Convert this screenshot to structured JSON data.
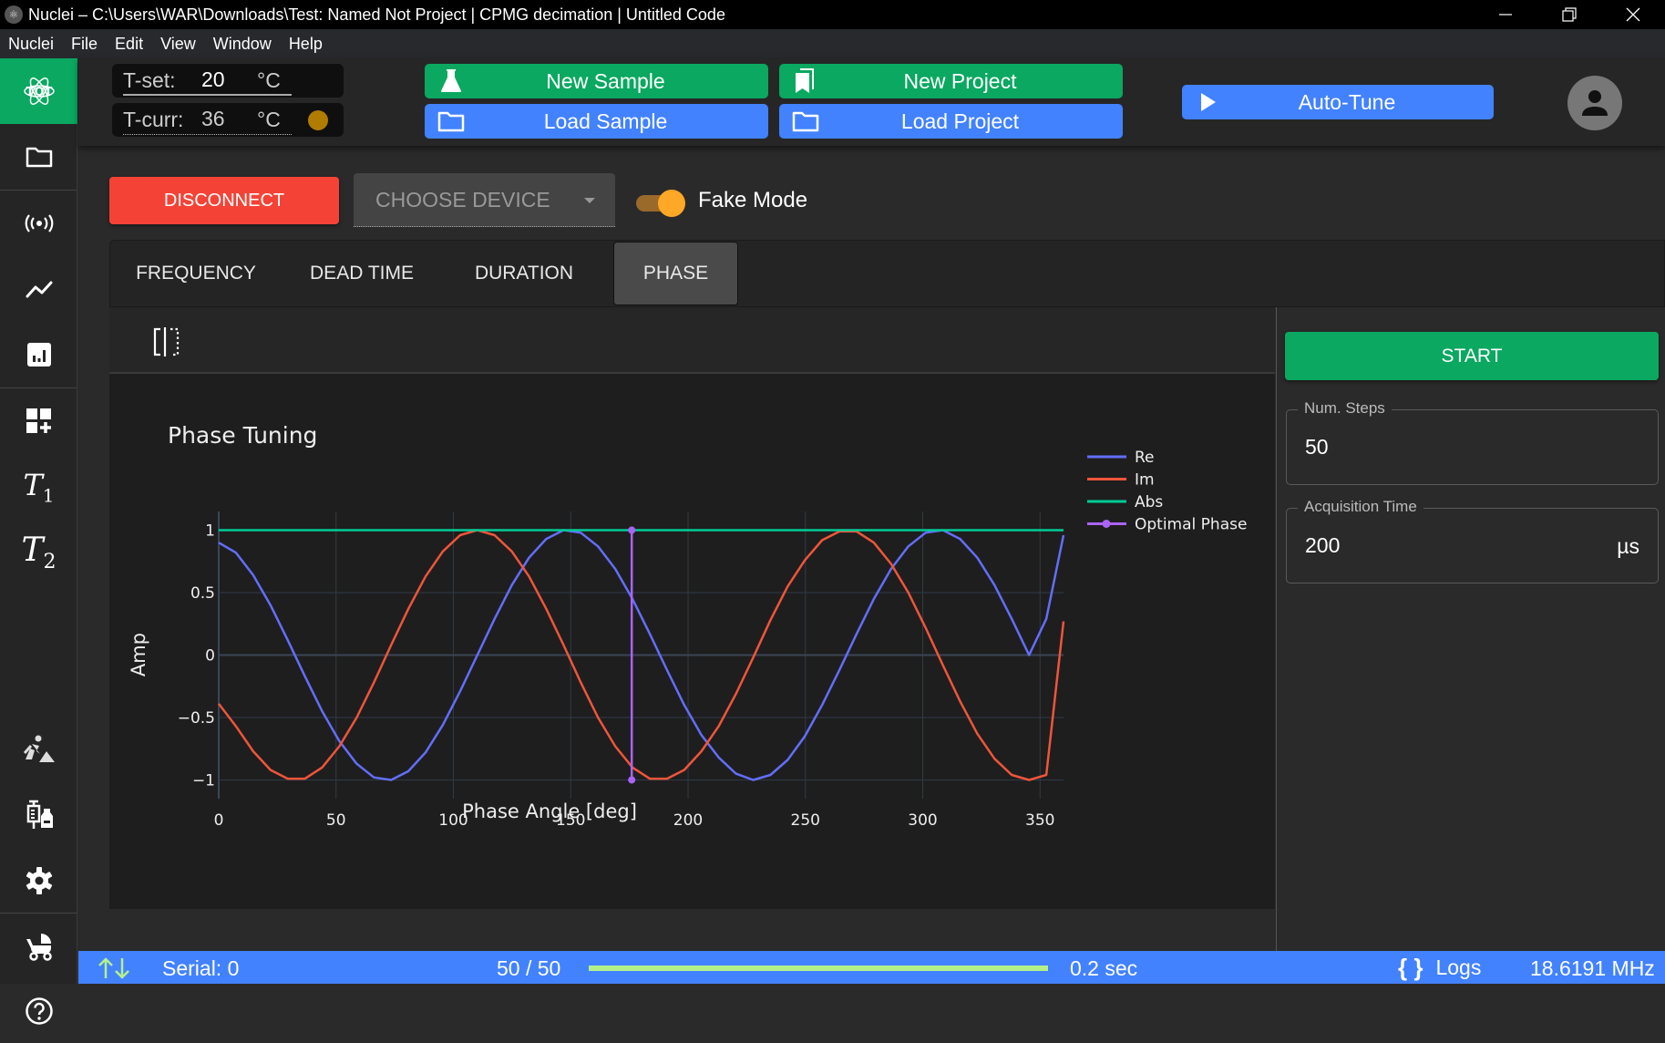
{
  "window": {
    "title": "Nuclei – C:\\Users\\WAR\\Downloads\\Test: Named Not Project | CPMG decimation | Untitled Code",
    "controls": [
      "minimize",
      "restore",
      "close"
    ]
  },
  "menu": [
    "Nuclei",
    "File",
    "Edit",
    "View",
    "Window",
    "Help"
  ],
  "sidebar": {
    "items": [
      {
        "name": "tqt-logo",
        "label": "TQT",
        "active": true
      },
      {
        "name": "folder",
        "icon": "folder-icon"
      },
      {
        "name": "signal",
        "icon": "broadcast-icon"
      },
      {
        "name": "timeline",
        "icon": "line-chart-icon"
      },
      {
        "name": "analytics",
        "icon": "bar-chart-icon"
      },
      {
        "name": "dashboard-add",
        "icon": "dashboard-add-icon"
      },
      {
        "name": "t1",
        "label": "T",
        "sub": "1"
      },
      {
        "name": "t2",
        "label": "T",
        "sub": "2"
      },
      {
        "name": "construction",
        "icon": "construction-icon"
      },
      {
        "name": "vaccines",
        "icon": "syringe-vial-icon"
      },
      {
        "name": "settings",
        "icon": "gear-icon"
      },
      {
        "name": "stroller",
        "icon": "stroller-icon"
      },
      {
        "name": "help",
        "icon": "help-icon"
      }
    ]
  },
  "header": {
    "t_set": {
      "label": "T-set:",
      "value": "20",
      "unit": "°C"
    },
    "t_curr": {
      "label": "T-curr:",
      "value": "36",
      "unit": "°C",
      "status_color": "#b07d00"
    },
    "new_sample": "New Sample",
    "load_sample": "Load Sample",
    "new_project": "New Project",
    "load_project": "Load Project",
    "auto_tune": "Auto-Tune"
  },
  "controls": {
    "disconnect": "DISCONNECT",
    "choose_device": "CHOOSE DEVICE",
    "fake_mode_label": "Fake Mode",
    "fake_mode_on": true
  },
  "tabs": [
    {
      "label": "FREQUENCY",
      "active": false
    },
    {
      "label": "DEAD TIME",
      "active": false
    },
    {
      "label": "DURATION",
      "active": false
    },
    {
      "label": "PHASE",
      "active": true
    }
  ],
  "right_panel": {
    "start": "START",
    "num_steps": {
      "label": "Num. Steps",
      "value": "50"
    },
    "acq_time": {
      "label": "Acquisition Time",
      "value": "200",
      "unit": "µs"
    }
  },
  "status": {
    "serial": "Serial: 0",
    "progress_text": "50 / 50",
    "progress_fraction": 1.0,
    "elapsed": "0.2 sec",
    "logs": "Logs",
    "frequency": "18.6191 MHz"
  },
  "colors": {
    "green": "#0aa860",
    "blue": "#4282ff",
    "red": "#f44336",
    "orange": "#ffa726"
  },
  "chart_data": {
    "type": "line",
    "title": "Phase Tuning",
    "xlabel": "Phase Angle [deg]",
    "ylabel": "Amp",
    "xlim": [
      0,
      360
    ],
    "ylim": [
      -1.15,
      1.15
    ],
    "xticks": [
      0,
      50,
      100,
      150,
      200,
      250,
      300,
      350
    ],
    "yticks": [
      -1,
      -0.5,
      0,
      0.5,
      1
    ],
    "ytick_labels": [
      "−1",
      "−0.5",
      "0",
      "0.5",
      "1"
    ],
    "grid": true,
    "legend_position": "right",
    "optimal_phase": 176,
    "x": [
      0,
      7.35,
      14.69,
      22.04,
      29.39,
      36.73,
      44.08,
      51.43,
      58.78,
      66.12,
      73.47,
      80.82,
      88.16,
      95.51,
      102.86,
      110.2,
      117.55,
      124.9,
      132.24,
      139.59,
      146.94,
      154.29,
      161.63,
      168.98,
      176.33,
      183.67,
      191.02,
      198.37,
      205.71,
      213.06,
      220.41,
      227.76,
      235.1,
      242.45,
      249.8,
      257.14,
      264.49,
      271.84,
      279.18,
      286.53,
      293.88,
      301.22,
      308.57,
      315.92,
      323.27,
      330.61,
      337.96,
      345.31,
      352.65,
      360
    ],
    "series": [
      {
        "name": "Re",
        "color": "#636efa",
        "values": [
          0.9,
          0.82,
          0.64,
          0.4,
          0.12,
          -0.17,
          -0.45,
          -0.69,
          -0.87,
          -0.98,
          -1.0,
          -0.93,
          -0.78,
          -0.56,
          -0.29,
          0.0,
          0.29,
          0.56,
          0.78,
          0.93,
          1.0,
          0.98,
          0.87,
          0.69,
          0.45,
          0.17,
          -0.12,
          -0.4,
          -0.64,
          -0.82,
          -0.95,
          -1.0,
          -0.96,
          -0.84,
          -0.65,
          -0.4,
          -0.12,
          0.17,
          0.45,
          0.69,
          0.87,
          0.98,
          1.0,
          0.93,
          0.78,
          0.56,
          0.29,
          0.0,
          0.29,
          0.96
        ]
      },
      {
        "name": "Im",
        "color": "#ef553b",
        "values": [
          -0.39,
          -0.57,
          -0.77,
          -0.92,
          -0.99,
          -0.99,
          -0.9,
          -0.73,
          -0.5,
          -0.22,
          0.08,
          0.37,
          0.63,
          0.83,
          0.96,
          1.0,
          0.96,
          0.83,
          0.63,
          0.37,
          0.08,
          -0.22,
          -0.5,
          -0.73,
          -0.9,
          -0.99,
          -0.99,
          -0.92,
          -0.77,
          -0.57,
          -0.31,
          -0.02,
          0.28,
          0.55,
          0.76,
          0.92,
          0.99,
          0.99,
          0.9,
          0.73,
          0.5,
          0.22,
          -0.08,
          -0.37,
          -0.63,
          -0.83,
          -0.96,
          -1.0,
          -0.96,
          0.27
        ]
      },
      {
        "name": "Abs",
        "color": "#00cc96",
        "values": [
          1,
          1,
          1,
          1,
          1,
          1,
          1,
          1,
          1,
          1,
          1,
          1,
          1,
          1,
          1,
          1,
          1,
          1,
          1,
          1,
          1,
          1,
          1,
          1,
          1,
          1,
          1,
          1,
          1,
          1,
          1,
          1,
          1,
          1,
          1,
          1,
          1,
          1,
          1,
          1,
          1,
          1,
          1,
          1,
          1,
          1,
          1,
          1,
          1,
          1
        ]
      },
      {
        "name": "Optimal Phase",
        "color": "#ab63fa",
        "x": [
          176,
          176
        ],
        "values": [
          -1,
          1
        ],
        "markers": true
      }
    ]
  }
}
